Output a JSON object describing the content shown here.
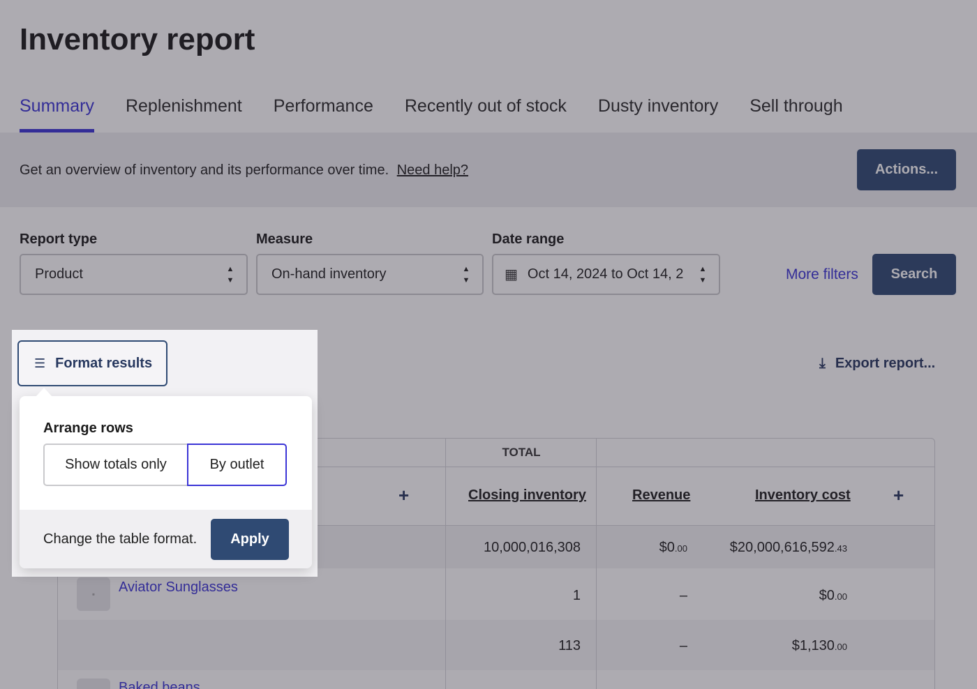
{
  "page": {
    "title": "Inventory report",
    "tabs": [
      {
        "label": "Summary",
        "active": true
      },
      {
        "label": "Replenishment"
      },
      {
        "label": "Performance"
      },
      {
        "label": "Recently out of stock"
      },
      {
        "label": "Dusty inventory"
      },
      {
        "label": "Sell through"
      }
    ],
    "description": "Get an overview of inventory and its performance over time.",
    "help_link": "Need help?",
    "actions_button": "Actions..."
  },
  "filters": {
    "report_type": {
      "label": "Report type",
      "value": "Product"
    },
    "measure": {
      "label": "Measure",
      "value": "On-hand inventory"
    },
    "date_range": {
      "label": "Date range",
      "value": "Oct 14, 2024 to Oct 14, 2"
    },
    "more_filters": "More filters",
    "search_button": "Search"
  },
  "toolbar": {
    "format_results": "Format results",
    "export_report": "Export report..."
  },
  "format_popover": {
    "title": "Arrange rows",
    "options": [
      "Show totals only",
      "By outlet"
    ],
    "selected": "By outlet",
    "hint": "Change the table format.",
    "apply": "Apply"
  },
  "table": {
    "group_header": "TOTAL",
    "columns": [
      "Closing inventory",
      "Revenue",
      "Inventory cost"
    ],
    "totals": {
      "closing_inventory": "10,000,016,308",
      "revenue": "$0",
      "revenue_cents": ".00",
      "inventory_cost": "$20,000,616,592",
      "inventory_cost_cents": ".43"
    },
    "rows": [
      {
        "product": "Aviator Sunglasses",
        "closing_inventory": "1",
        "revenue": "–",
        "inventory_cost": "$0",
        "inventory_cost_cents": ".00"
      },
      {
        "product": "",
        "closing_inventory": "113",
        "revenue": "–",
        "inventory_cost": "$1,130",
        "inventory_cost_cents": ".00"
      },
      {
        "product": "Baked beans"
      }
    ]
  },
  "colors": {
    "accent": "#3b34d6",
    "primary_button": "#2f4a73"
  }
}
